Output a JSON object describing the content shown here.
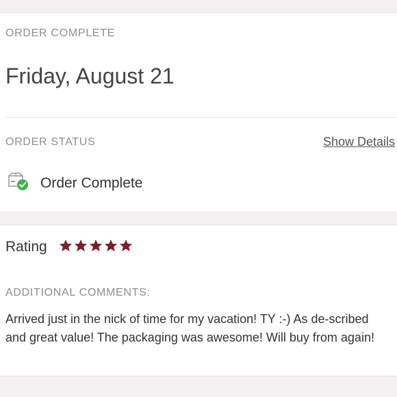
{
  "order": {
    "header_label": "ORDER COMPLETE",
    "date": "Friday, August 21",
    "status_label": "ORDER STATUS",
    "show_details": "Show Details",
    "status_text": "Order Complete",
    "status_icon": "package-check-icon"
  },
  "rating": {
    "label": "Rating",
    "stars": 5,
    "max_stars": 5,
    "star_color": "#7a1f2b",
    "comments_label": "ADDITIONAL COMMENTS:",
    "comment": "Arrived just in the nick of time for my vacation! TY :-) As de-scribed and great value! The packaging was awesome! Will buy from again!"
  },
  "colors": {
    "background": "#f5f1f2",
    "card": "#ffffff",
    "muted_text": "#8e8e8e",
    "check_green": "#3fb24f"
  }
}
